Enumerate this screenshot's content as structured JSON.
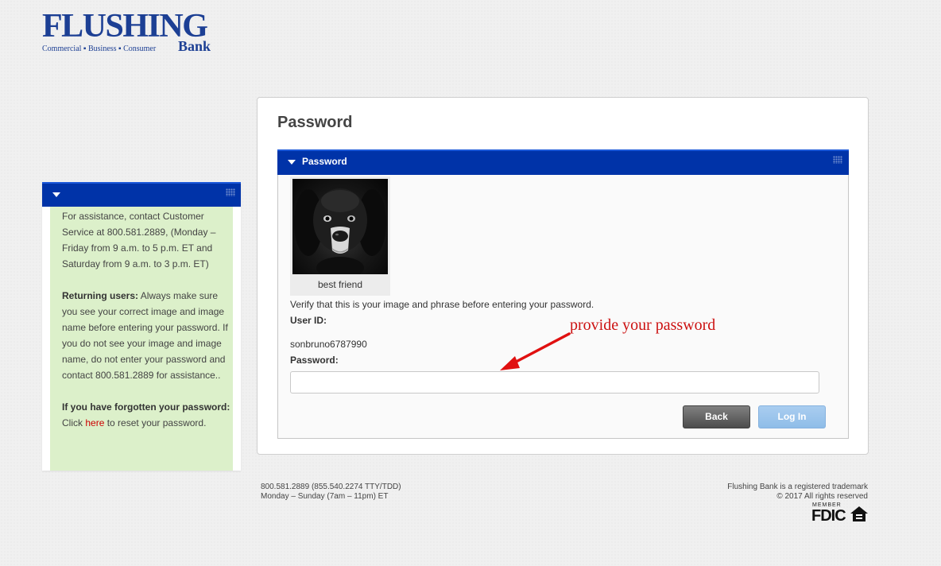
{
  "logo": {
    "name": "FLUSHING",
    "tagline": "Commercial ▪ Business ▪ Consumer",
    "bank": "Bank"
  },
  "sidebar": {
    "assistance": "For assistance, contact Customer Service at 800.581.2889, (Monday – Friday from 9 a.m. to 5 p.m. ET and Saturday from 9 a.m. to 3 p.m. ET)",
    "returning_label": "Returning users:",
    "returning_text": " Always make sure you see your correct image and image name before entering your password. If you do not see your image and image name, do not enter your password and contact 800.581.2889 for assistance..",
    "forgot_label": "If you have forgotten your password:",
    "forgot_pre": " Click ",
    "forgot_link": "here",
    "forgot_post": " to reset your password."
  },
  "main": {
    "title": "Password",
    "panel_title": "Password",
    "image_caption": "best friend",
    "verify_text": "Verify that this is your image and phrase before entering your password.",
    "user_id_label": "User ID:",
    "user_id_value": "sonbruno6787990",
    "password_label": "Password:",
    "password_value": "",
    "back_label": "Back",
    "login_label": "Log In"
  },
  "annotation": {
    "text": "provide your password",
    "color": "#cc1111"
  },
  "footer": {
    "phone": "800.581.2889 (855.540.2274 TTY/TDD)",
    "hours": "Monday – Sunday (7am – 11pm) ET",
    "trademark": "Flushing Bank is a registered trademark",
    "copyright": "© 2017 All rights reserved",
    "fdic_member": "MEMBER",
    "fdic": "FDIC"
  },
  "colors": {
    "brand": "#1c3f94",
    "panel_header": "#0033a8",
    "sidebar_bg": "#dcf0ca",
    "link": "#cc0000"
  },
  "icons": {
    "collapse": "caret-down-icon",
    "drag": "grip-icon",
    "equal_housing": "equal-housing-lender-icon"
  }
}
